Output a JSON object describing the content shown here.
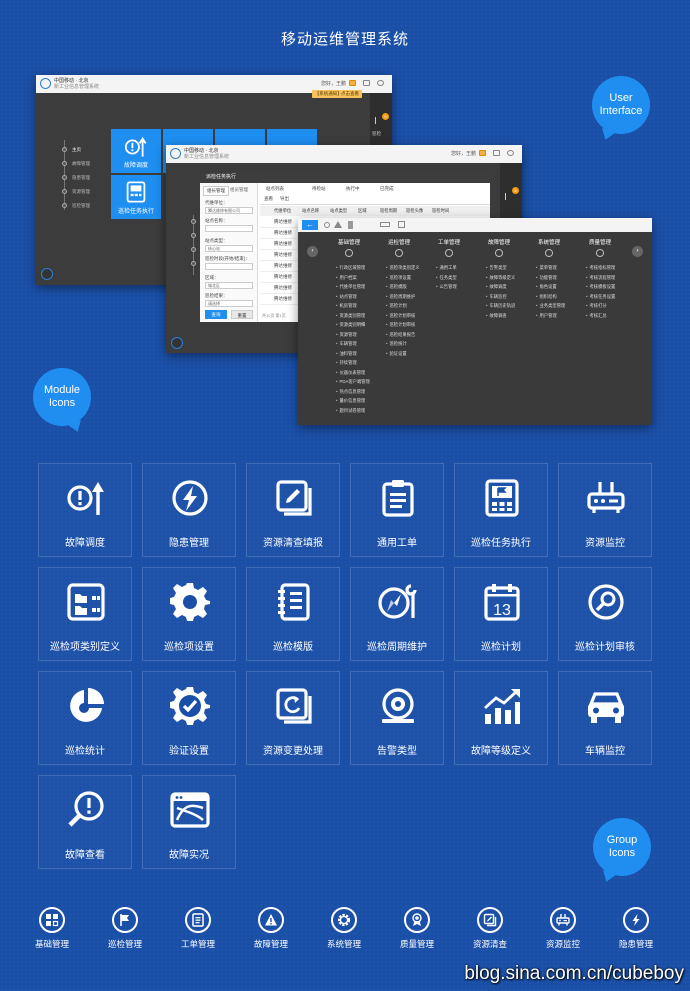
{
  "page_title": "移动运维管理系统",
  "bubbles": {
    "user_interface": "User Interface",
    "module_icons": "Module Icons",
    "group_icons": "Group Icons"
  },
  "screen1": {
    "brand": "中国移动 · 北京",
    "brand_sub": "新工业信息管理系统",
    "user": "您好，王鹏",
    "notice": "【系统通知】·点击查看",
    "side_badge": "5",
    "side_label": "巡检",
    "nav": [
      "主页",
      "故障管理",
      "隐患管理",
      "资源管理",
      "巡检管理"
    ],
    "tiles": [
      "故障调度",
      "巡检任务执行"
    ]
  },
  "screen2": {
    "brand": "中国移动 · 北京",
    "brand_sub": "新工业信息管理系统",
    "user": "您好，王鹏",
    "side_badge": "5",
    "dialog_title": "派检任务执行",
    "tabs": [
      "组长管理",
      "组员管理"
    ],
    "fields": [
      {
        "label": "代维单位：",
        "value": "腾达维修有限公司"
      },
      {
        "label": "站点名称：",
        "value": ""
      },
      {
        "label": "站点类型：",
        "value": "核心站"
      },
      {
        "label": "巡检时段(开始/结束)：",
        "value": ""
      },
      {
        "label": "区域：",
        "value": "城北区"
      },
      {
        "label": "巡检结果：",
        "value": "请选择"
      }
    ],
    "query_btn": "查询",
    "reset_btn": "重置",
    "subtabs": [
      "站点列表",
      "待检站",
      "执行中",
      "已完成"
    ],
    "toolbar": [
      "查看",
      "导出"
    ],
    "table_headers": [
      "代维单位",
      "站点名称",
      "站点类型",
      "区域",
      "巡检周期",
      "巡检头像",
      "巡检时间"
    ],
    "row_text": "腾达维修",
    "pager": "共10页 第1页"
  },
  "screen3": {
    "columns": [
      {
        "title": "基础管理",
        "items": [
          "行政区域管理",
          "用户档案",
          "代维单位管理",
          "站点管理",
          "机房管理",
          "资源类别管理",
          "资源类别明细",
          "资源管理",
          "车辆管理",
          "油料管理",
          "持续管理",
          "仪器仪表管理",
          "PDA客户端管理",
          "热点信息管理",
          "量价信息管理",
          "题目试卷管理"
        ]
      },
      {
        "title": "运检管理",
        "items": [
          "巡检项类别定义",
          "巡检项设置",
          "巡检模版",
          "巡检周期维护",
          "巡检计划",
          "巡检计划审核",
          "巡检计划审核",
          "巡检结果报告",
          "巡检统计",
          "验证设置"
        ]
      },
      {
        "title": "工单管理",
        "items": [
          "通用工单",
          "任务类型",
          "公告管理"
        ]
      },
      {
        "title": "故障管理",
        "items": [
          "告警类型",
          "故障等级定义",
          "故障调度",
          "车辆监控",
          "车辆历史轨迹",
          "故障调查"
        ]
      },
      {
        "title": "系统管理",
        "items": [
          "菜单管理",
          "功能管理",
          "角色设置",
          "组织结构",
          "业务类型管理",
          "用户管理"
        ]
      },
      {
        "title": "质量管理",
        "items": [
          "考核指标管理",
          "考核流程管理",
          "考核模板设置",
          "考核任务设置",
          "考核打分",
          "考核汇总"
        ]
      }
    ]
  },
  "modules": [
    {
      "label": "故障调度",
      "icon": "fault-dispatch-icon"
    },
    {
      "label": "隐患管理",
      "icon": "hazard-icon"
    },
    {
      "label": "资源清查填报",
      "icon": "resource-report-icon"
    },
    {
      "label": "通用工单",
      "icon": "work-order-icon"
    },
    {
      "label": "巡检任务执行",
      "icon": "inspection-task-icon"
    },
    {
      "label": "资源监控",
      "icon": "resource-monitor-icon"
    },
    {
      "label": "巡检项类别定义",
      "icon": "category-define-icon"
    },
    {
      "label": "巡检项设置",
      "icon": "gear-icon"
    },
    {
      "label": "巡检模版",
      "icon": "template-icon"
    },
    {
      "label": "巡检周期维护",
      "icon": "cycle-maintain-icon"
    },
    {
      "label": "巡检计划",
      "icon": "calendar-icon"
    },
    {
      "label": "巡检计划审核",
      "icon": "plan-review-icon"
    },
    {
      "label": "巡检统计",
      "icon": "pie-chart-icon"
    },
    {
      "label": "验证设置",
      "icon": "verify-gear-icon"
    },
    {
      "label": "资源变更处理",
      "icon": "resource-change-icon"
    },
    {
      "label": "告警类型",
      "icon": "alarm-bell-icon"
    },
    {
      "label": "故障等级定义",
      "icon": "bar-trend-icon"
    },
    {
      "label": "车辆监控",
      "icon": "car-icon"
    },
    {
      "label": "故障查看",
      "icon": "fault-search-icon"
    },
    {
      "label": "故障实况",
      "icon": "fault-live-icon"
    }
  ],
  "groups": [
    {
      "label": "基础管理",
      "icon": "grid-icon"
    },
    {
      "label": "巡检管理",
      "icon": "flag-icon"
    },
    {
      "label": "工单管理",
      "icon": "document-icon"
    },
    {
      "label": "故障管理",
      "icon": "warning-icon"
    },
    {
      "label": "系统管理",
      "icon": "gear-icon"
    },
    {
      "label": "质量管理",
      "icon": "medal-icon"
    },
    {
      "label": "资源清查",
      "icon": "edit-icon"
    },
    {
      "label": "资源监控",
      "icon": "router-icon"
    },
    {
      "label": "隐患管理",
      "icon": "lightning-icon"
    }
  ],
  "footer": "blog.sina.com.cn/cubeboy"
}
